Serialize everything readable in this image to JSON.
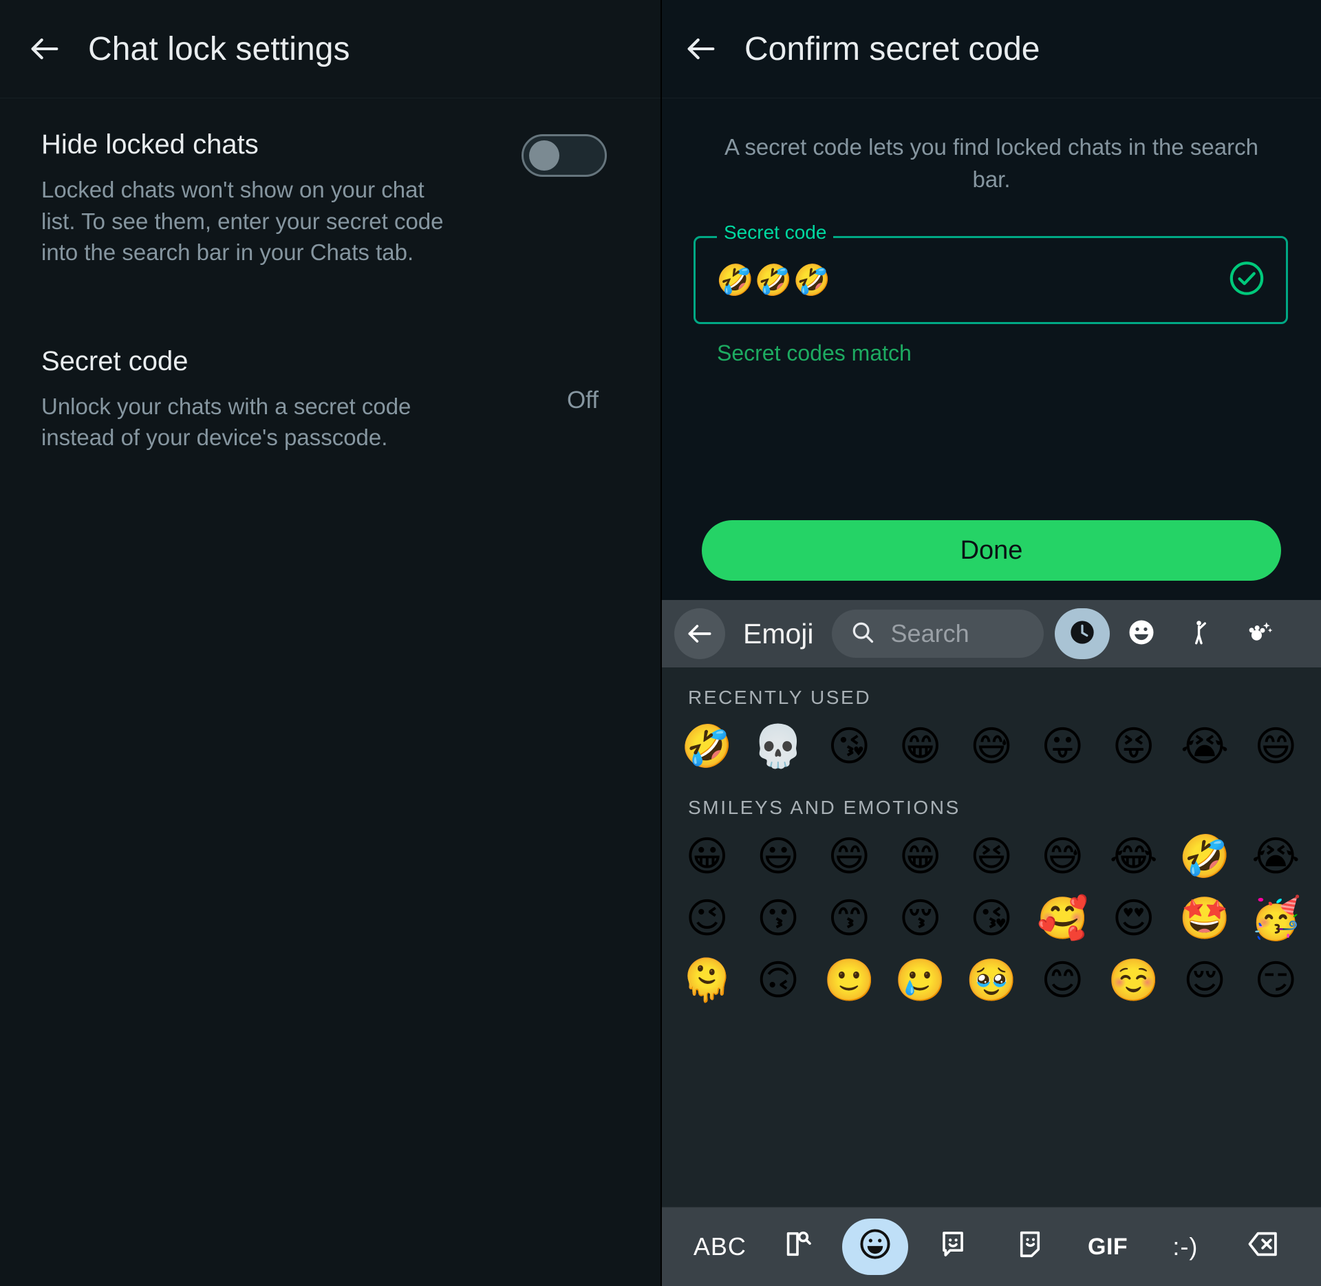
{
  "left": {
    "appbar": {
      "back_icon": "arrow-left-icon",
      "title": "Chat lock settings"
    },
    "hide_locked_chats": {
      "title": "Hide locked chats",
      "description": "Locked chats won't show on your chat list. To see them, enter your secret code into the search bar in your Chats tab.",
      "toggle_state": "off"
    },
    "secret_code": {
      "title": "Secret code",
      "description": "Unlock your chats with a secret code instead of your device's passcode.",
      "value": "Off"
    }
  },
  "right": {
    "appbar": {
      "back_icon": "arrow-left-icon",
      "title": "Confirm secret code"
    },
    "description": "A secret code lets you find locked chats in the search bar.",
    "field": {
      "legend": "Secret code",
      "value": "🤣🤣🤣",
      "valid_icon": "check-circle-icon",
      "helper": "Secret codes match"
    },
    "done_label": "Done",
    "accent_green": "#00a884",
    "button_green": "#25d366",
    "helper_green": "#1dab61"
  },
  "keyboard": {
    "header": {
      "back_icon": "arrow-left-icon",
      "title": "Emoji",
      "search_icon": "search-icon",
      "search_placeholder": "Search",
      "categories": [
        {
          "name": "recent-clock-icon",
          "active": true
        },
        {
          "name": "smiley-icon",
          "active": false
        },
        {
          "name": "person-icon",
          "active": false
        },
        {
          "name": "animals-nature-icon",
          "active": false
        }
      ]
    },
    "sections": [
      {
        "label": "RECENTLY USED",
        "emojis": [
          "🤣",
          "💀",
          "😘",
          "😁",
          "😅",
          "😛",
          "😝",
          "😭",
          "😄"
        ]
      },
      {
        "label": "SMILEYS AND EMOTIONS",
        "emojis": [
          "😀",
          "😃",
          "😄",
          "😁",
          "😆",
          "😅",
          "😂",
          "🤣",
          "😭",
          "😉",
          "😗",
          "😙",
          "😚",
          "😘",
          "🥰",
          "😍",
          "🤩",
          "🥳",
          "🫠",
          "🙃",
          "🙂",
          "🥲",
          "🥹",
          "😊",
          "☺️",
          "😌",
          "😏"
        ]
      }
    ],
    "footer_keys": [
      {
        "name": "abc-key",
        "label": "ABC",
        "style": "abc",
        "active": false
      },
      {
        "name": "clipboard-search-icon",
        "label": "",
        "style": "icon-clipboard",
        "active": false
      },
      {
        "name": "emoji-key",
        "label": "",
        "style": "icon-smiley",
        "active": true
      },
      {
        "name": "sticker-key",
        "label": "",
        "style": "icon-speech-smiley",
        "active": false
      },
      {
        "name": "avatar-sticker-key",
        "label": "",
        "style": "icon-card-smiley",
        "active": false
      },
      {
        "name": "gif-key",
        "label": "GIF",
        "style": "gif",
        "active": false
      },
      {
        "name": "emoticon-key",
        "label": ":-)",
        "style": "emoticon",
        "active": false
      },
      {
        "name": "backspace-key",
        "label": "",
        "style": "icon-backspace",
        "active": false
      }
    ]
  }
}
